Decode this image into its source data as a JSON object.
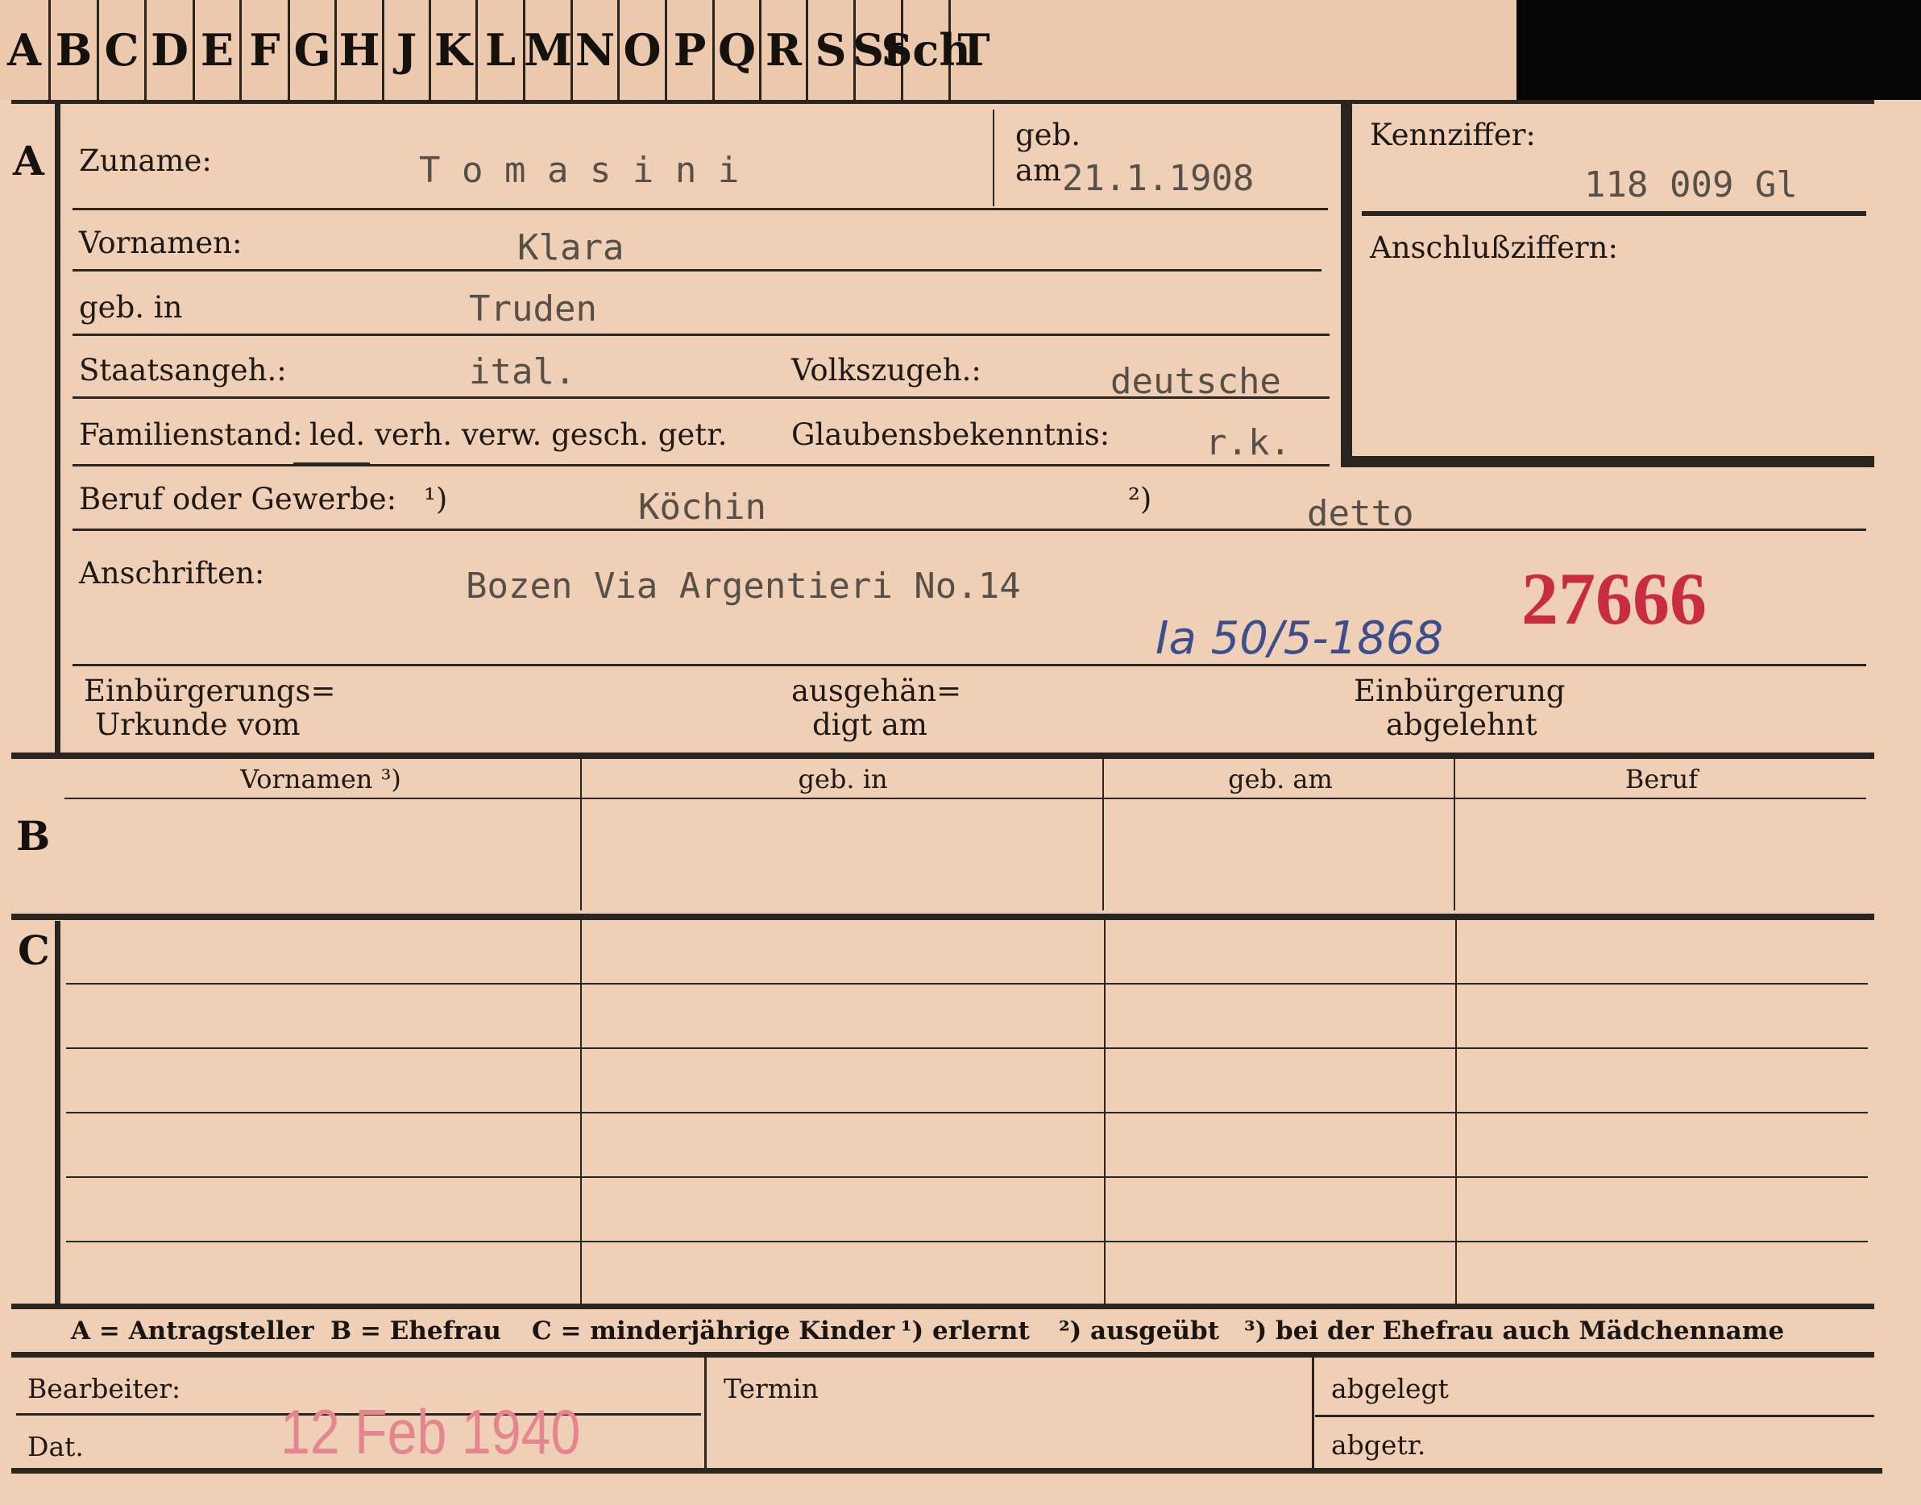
{
  "tabs": [
    "A",
    "B",
    "C",
    "D",
    "E",
    "F",
    "G",
    "H",
    "J",
    "K",
    "L",
    "M",
    "N",
    "O",
    "P",
    "Q",
    "R",
    "S",
    "St",
    "Sch",
    "T"
  ],
  "sections": {
    "a": "A",
    "b": "B",
    "c": "C"
  },
  "colors": {
    "card": "#efcfb5",
    "ink": "#1e1914",
    "typewriter": "#565049",
    "red_number": "#c92b3f",
    "stamp": "#e5858f",
    "pencil_blue": "#3d4f8a"
  },
  "fields": {
    "zuname_label": "Zuname:",
    "zuname_value": "T o m a s i n i",
    "geb_label": "geb.",
    "geb_am_label": "am",
    "geb_am_value": "21.1.1908",
    "kennziffer_label": "Kennziffer:",
    "kennziffer_value": "118 009  Gl",
    "anschluss_label": "Anschlußziffern:",
    "vornamen_label": "Vornamen:",
    "vornamen_value": "Klara",
    "geb_in_label": "geb. in",
    "geb_in_value": "Truden",
    "staatsangeh_label": "Staatsangeh.:",
    "staatsangeh_value": "ital.",
    "volkszugeh_label": "Volkszugeh.:",
    "volkszugeh_value": "deutsche",
    "familienstand_label": "Familienstand:",
    "familienstand_options": "led. verh. verw. gesch. getr.",
    "glaubens_label": "Glaubensbekenntnis:",
    "glaubens_value": "r.k.",
    "beruf_label": "Beruf oder Gewerbe:",
    "fn1": "¹)",
    "fn2": "²)",
    "beruf1_value": "Köchin",
    "beruf2_value": "detto",
    "anschriften_label": "Anschriften:",
    "anschriften_value": "Bozen Via Argentieri No.14",
    "red_number": "27666",
    "handwritten": "Ia 50/5-1868",
    "einb_urkunde_l1": "Einbürgerungs=",
    "einb_urkunde_l2": "Urkunde vom",
    "ausgehaend_l1": "ausgehän=",
    "ausgehaend_l2": "digt am",
    "einb_abgelehnt_l1": "Einbürgerung",
    "einb_abgelehnt_l2": "abgelehnt"
  },
  "table_headers": [
    "Vornamen ³)",
    "geb. in",
    "geb. am",
    "Beruf"
  ],
  "legend": {
    "a": "A = Antragsteller",
    "b": "B = Ehefrau",
    "c": "C = minderjährige Kinder",
    "n1": "¹) erlernt",
    "n2": "²) ausgeübt",
    "n3": "³) bei der Ehefrau auch Mädchenname"
  },
  "footer": {
    "bearbeiter": "Bearbeiter:",
    "dat": "Dat.",
    "stamp_date": "12 Feb 1940",
    "termin": "Termin",
    "abgelegt": "abgelegt",
    "abgetr": "abgetr."
  }
}
